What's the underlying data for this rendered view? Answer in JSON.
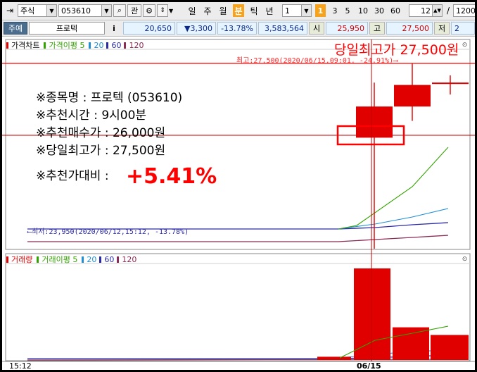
{
  "toolbar": {
    "market": "주식",
    "code": "053610",
    "search_label": "관",
    "periods": [
      "일",
      "주",
      "월",
      "분",
      "틱",
      "년"
    ],
    "period_selected": "분",
    "interval_value": "1",
    "minute_options": [
      "1",
      "3",
      "5",
      "10",
      "30",
      "60"
    ],
    "minute_selected": "1",
    "count_value": "12",
    "slash": "/",
    "total_value": "1200"
  },
  "quote": {
    "tab_label": "주예",
    "name": "프로텍",
    "info_label": "i",
    "price": "20,650",
    "change": "▼3,300",
    "change_rate": "-13.78%",
    "volume": "3,583,564",
    "open_label": "시",
    "open": "25,950",
    "high_label": "고",
    "high": "27,500",
    "low_label": "저",
    "low": "2"
  },
  "price_panel": {
    "title": "가격차트",
    "ma_label": "가격이평 5",
    "ma_periods": [
      "20",
      "60",
      "120"
    ],
    "high_marker": "최고:27,500(2020/06/15,09:01, -24.91%)⟶",
    "low_marker": "⟵최저:23,950(2020/06/12,15:12, -13.78%)"
  },
  "volume_panel": {
    "title": "거래량",
    "ma_label": "거래이평 5",
    "ma_periods": [
      "20",
      "60",
      "120"
    ]
  },
  "annotation": {
    "headline": "당일최고가 27,500원",
    "lines": [
      "※종목명 : 프로텍 (053610)",
      "※추천시간 : 9시00분",
      "※추천매수가 : 26,000원",
      "※당일최고가 : 27,500원"
    ],
    "ratio_label": "※추천가대비 : ",
    "ratio_value": "+5.41%"
  },
  "x_axis": {
    "left_label": "15:12",
    "date_label": "06/15"
  },
  "colors": {
    "up": "#e00000",
    "down": "#0000c8",
    "ma5": "#33a300",
    "ma20": "#1f8fd6",
    "ma60": "#2a2aa8",
    "ma120": "#8a2a55",
    "highlight": "#ff0000",
    "period_selected": "#f7a21b"
  },
  "chart_data": {
    "type": "candlestick",
    "x": [
      "06/12 15:12",
      "06/15 09:00",
      "06/15 09:01",
      "06/15 09:02"
    ],
    "candles": [
      {
        "open": 23950,
        "high": 23950,
        "low": 23950,
        "close": 23950
      },
      {
        "open": 25950,
        "high": 27100,
        "low": 20650,
        "close": 26600
      },
      {
        "open": 26600,
        "high": 27500,
        "low": 26300,
        "close": 27050
      },
      {
        "open": 27100,
        "high": 27250,
        "low": 26850,
        "close": 27100
      }
    ],
    "recommended_buy_price": 26000,
    "day_high": 27500,
    "volume": [
      15000,
      420000,
      150000,
      115000
    ]
  }
}
